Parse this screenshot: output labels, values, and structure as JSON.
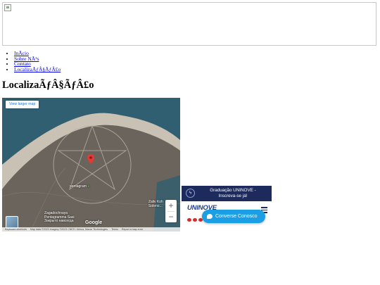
{
  "banner": {
    "image": "broken-image-icon"
  },
  "nav": {
    "items": [
      {
        "label": "InÃ­cio"
      },
      {
        "label": "Sobre NÃ³s"
      },
      {
        "label": "Contato"
      },
      {
        "label": "LocalizaÃƒÂ§ÃƒÂ£o"
      }
    ]
  },
  "page": {
    "title": "LocalizaÃƒÂ§ÃƒÂ£o"
  },
  "map": {
    "larger_map_label": "View larger map",
    "labels": {
      "pentagram": "pentagram",
      "zaliv_line1": "Zaliv Koh",
      "zaliv_line2": "Soleno...",
      "zagad_line1": "Zagadochnaya",
      "zagad_line2": "Pentagramma Sasi",
      "zagad_line3": "Закрыто навсегда"
    },
    "google": "Google",
    "zoom_in": "+",
    "zoom_out": "−",
    "attribution": {
      "shortcuts": "Keyboard shortcuts",
      "data": "Map data ©2023 Imagery ©2023 CNES / Airbus, Maxar Technologies",
      "terms": "Terms",
      "report": "Report a map error"
    },
    "colors": {
      "land": "#6b645c",
      "sand": "#c9c1b3",
      "water": "#2f5f70",
      "pin": "#e53935"
    }
  },
  "ad": {
    "header_line1": "Graduação UNINOVE -",
    "header_line2": "Inscreva-se já!",
    "logo": "UNINOVE",
    "icon": "lightning-icon"
  },
  "chat": {
    "label": "Converse Conosco",
    "color": "#1a9ee6"
  }
}
